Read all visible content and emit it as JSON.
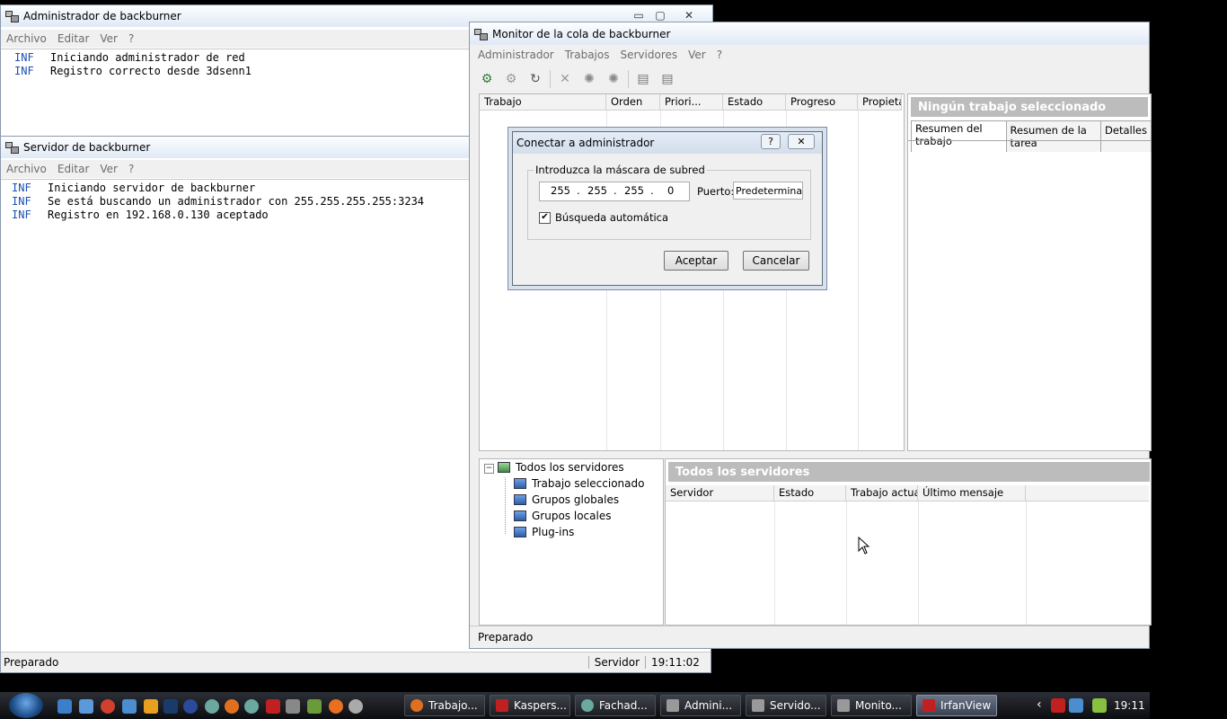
{
  "admin_window": {
    "title": "Administrador de backburner",
    "menu": [
      "Archivo",
      "Editar",
      "Ver",
      "?"
    ],
    "log": [
      {
        "level": "INF",
        "text": "Iniciando administrador de red"
      },
      {
        "level": "INF",
        "text": "Registro correcto desde 3dsenn1"
      }
    ]
  },
  "server_window": {
    "title": "Servidor de backburner",
    "menu": [
      "Archivo",
      "Editar",
      "Ver",
      "?"
    ],
    "log": [
      {
        "level": "INF",
        "text": "Iniciando servidor de backburner"
      },
      {
        "level": "INF",
        "text": "Se está buscando un administrador con 255.255.255.255:3234"
      },
      {
        "level": "INF",
        "text": "Registro en 192.168.0.130 aceptado"
      }
    ],
    "status": "Preparado",
    "status_role": "Servidor",
    "status_time": "19:11:02"
  },
  "monitor_window": {
    "title": "Monitor de la cola de backburner",
    "menu": [
      "Administrador",
      "Trabajos",
      "Servidores",
      "Ver",
      "?"
    ],
    "toolbar_icons": [
      "connect-icon",
      "disconnect-icon",
      "refresh-icon",
      "delete-icon",
      "activate-icon",
      "deactivate-icon",
      "server-icon",
      "server-alt-icon"
    ],
    "jobs_columns": [
      "Trabajo",
      "Orden",
      "Priori...",
      "Estado",
      "Progreso",
      "Propietario"
    ],
    "details_header": "Ningún trabajo seleccionado",
    "details_tabs": [
      "Resumen del trabajo",
      "Resumen de la tarea",
      "Detalles"
    ],
    "tree_root": "Todos los servidores",
    "tree_children": [
      "Trabajo seleccionado",
      "Grupos globales",
      "Grupos locales",
      "Plug-ins"
    ],
    "servers_header": "Todos los servidores",
    "servers_columns": [
      "Servidor",
      "Estado",
      "Trabajo actual",
      "Último mensaje"
    ],
    "status": "Preparado"
  },
  "dialog": {
    "title": "Conectar a administrador",
    "group_label": "Introduzca la máscara de subred",
    "ip": [
      "255",
      "255",
      "255",
      "0"
    ],
    "port_label": "Puerto:",
    "port_value": "Predeterminado",
    "auto_label": "Búsqueda automática",
    "auto_checked": true,
    "ok": "Aceptar",
    "cancel": "Cancelar",
    "help_glyph": "?",
    "close_glyph": "✕"
  },
  "taskbar": {
    "buttons": [
      "Trabajo...",
      "Kaspers...",
      "Fachad...",
      "Admini...",
      "Servido...",
      "Monito...",
      "IrfanView"
    ],
    "clock": "19:11"
  }
}
